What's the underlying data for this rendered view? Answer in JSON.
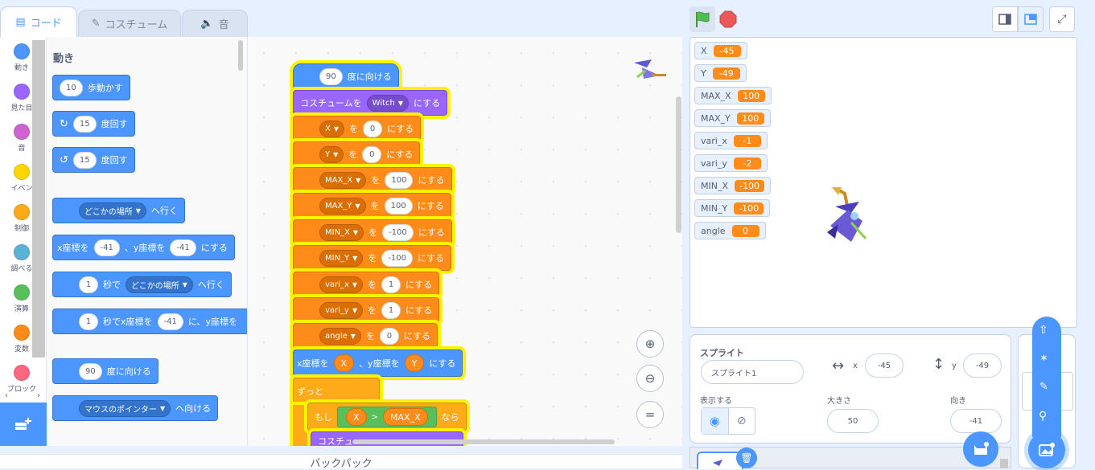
{
  "tabs": [
    {
      "label": "コード",
      "icon": "code-icon",
      "active": true
    },
    {
      "label": "コスチューム",
      "icon": "brush-icon",
      "active": false
    },
    {
      "label": "音",
      "icon": "speaker-icon",
      "active": false
    }
  ],
  "categories": [
    {
      "label": "動き",
      "color": "#4c97ff"
    },
    {
      "label": "見た目",
      "color": "#9966ff"
    },
    {
      "label": "音",
      "color": "#cf63cf"
    },
    {
      "label": "イベン",
      "color": "#ffd500"
    },
    {
      "label": "制御",
      "color": "#ffab19"
    },
    {
      "label": "調べる",
      "color": "#5cb1d6"
    },
    {
      "label": "演算",
      "color": "#59c059"
    },
    {
      "label": "変数",
      "color": "#ff8c1a"
    },
    {
      "label": "ブロック",
      "color": "#ff6680"
    }
  ],
  "palette": {
    "heading": "動き",
    "move": {
      "value": "10",
      "text": "歩動かす"
    },
    "turn_right": {
      "value": "15",
      "text": "度回す"
    },
    "turn_left": {
      "value": "15",
      "text": "度回す"
    },
    "goto": {
      "menu": "どこかの場所",
      "text": "へ行く"
    },
    "goto_xy": {
      "t1": "x座標を",
      "x": "-41",
      "t2": "、y座標を",
      "y": "-41",
      "t3": "にする"
    },
    "glide": {
      "secs": "1",
      "t1": "秒で",
      "menu": "どこかの場所",
      "t2": "へ行く"
    },
    "glide_xy": {
      "secs": "1",
      "t1": "秒でx座標を",
      "x": "-41",
      "t2": "に、y座標を"
    },
    "point_dir": {
      "value": "90",
      "text": "度に向ける"
    },
    "point_towards": {
      "menu": "マウスのポインター",
      "text": "へ向ける"
    }
  },
  "script": {
    "point_dir": {
      "value": "90",
      "text": "度に向ける"
    },
    "costume": {
      "t1": "コスチュームを",
      "menu": "Witch",
      "t2": "にする"
    },
    "sets": [
      {
        "var": "X",
        "value": "0"
      },
      {
        "var": "Y",
        "value": "0"
      },
      {
        "var": "MAX_X",
        "value": "100"
      },
      {
        "var": "MAX_Y",
        "value": "100"
      },
      {
        "var": "MIN_X",
        "value": "-100"
      },
      {
        "var": "MIN_Y",
        "value": "-100"
      },
      {
        "var": "vari_x",
        "value": "1"
      },
      {
        "var": "vari_y",
        "value": "1"
      },
      {
        "var": "angle",
        "value": "0"
      }
    ],
    "set_wo": "を",
    "set_suru": "にする",
    "goto_xy": {
      "t1": "x座標を",
      "x": "X",
      "t2": "、y座標を",
      "y": "Y",
      "t3": "にする"
    },
    "forever": "ずっと",
    "if": {
      "t1": "もし",
      "left": "X",
      "op": ">",
      "right": "MAX_X",
      "t2": "なら"
    },
    "partial": "コスチュ"
  },
  "backpack": "バックパック",
  "monitors": [
    {
      "name": "X",
      "value": "-45"
    },
    {
      "name": "Y",
      "value": "-49"
    },
    {
      "name": "MAX_X",
      "value": "100"
    },
    {
      "name": "MAX_Y",
      "value": "100"
    },
    {
      "name": "vari_x",
      "value": "-1"
    },
    {
      "name": "vari_y",
      "value": "-2"
    },
    {
      "name": "MIN_X",
      "value": "-100"
    },
    {
      "name": "MIN_Y",
      "value": "-100"
    },
    {
      "name": "angle",
      "value": "0"
    }
  ],
  "sprite_info": {
    "heading": "スプライト",
    "name": "スプライト1",
    "x_label": "x",
    "x": "-45",
    "y_label": "y",
    "y": "-49",
    "show_label": "表示する",
    "size_label": "大きさ",
    "size": "50",
    "direction_label": "向き",
    "direction": "-41"
  }
}
